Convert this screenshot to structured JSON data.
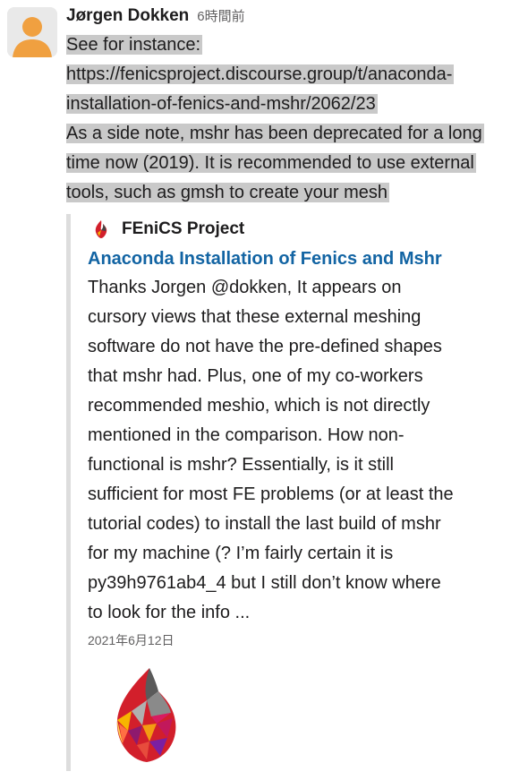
{
  "message": {
    "author": "Jørgen Dokken",
    "time": "6時間前",
    "lines": [
      "See for instance:",
      "https://fenicsproject.discourse.group/t/anaconda-",
      "installation-of-fenics-and-mshr/2062/23",
      "As a side note, mshr has been deprecated for a long",
      "time now (2019). It is recommended to use external",
      "tools, such as gmsh to create your mesh"
    ]
  },
  "attachment": {
    "site_name": "FEniCS Project",
    "title": "Anaconda Installation of Fenics and Mshr",
    "body_lines": [
      "Thanks Jorgen @dokken, It appears on",
      "cursory views that these external meshing",
      "software do not have the pre-defined shapes",
      "that mshr had. Plus, one of my co-workers",
      "recommended meshio, which is not directly",
      "mentioned in the comparison. How non-",
      "functional is mshr? Essentially, is it still",
      "sufficient for most FE problems (or at least the",
      "tutorial codes) to install the last build of mshr",
      "for my machine (? I’m fairly certain it is",
      "py39h9761ab4_4 but I still don’t know where",
      "to look for the info ..."
    ],
    "date": "2021年6月12日",
    "icons": {
      "site": "fenics-logo-icon",
      "preview": "fenics-logo-image"
    }
  },
  "colors": {
    "highlight": "#c9c9c9",
    "link_blue": "#1264a3",
    "avatar_orange": "#f0a040",
    "border": "#dddddd"
  }
}
